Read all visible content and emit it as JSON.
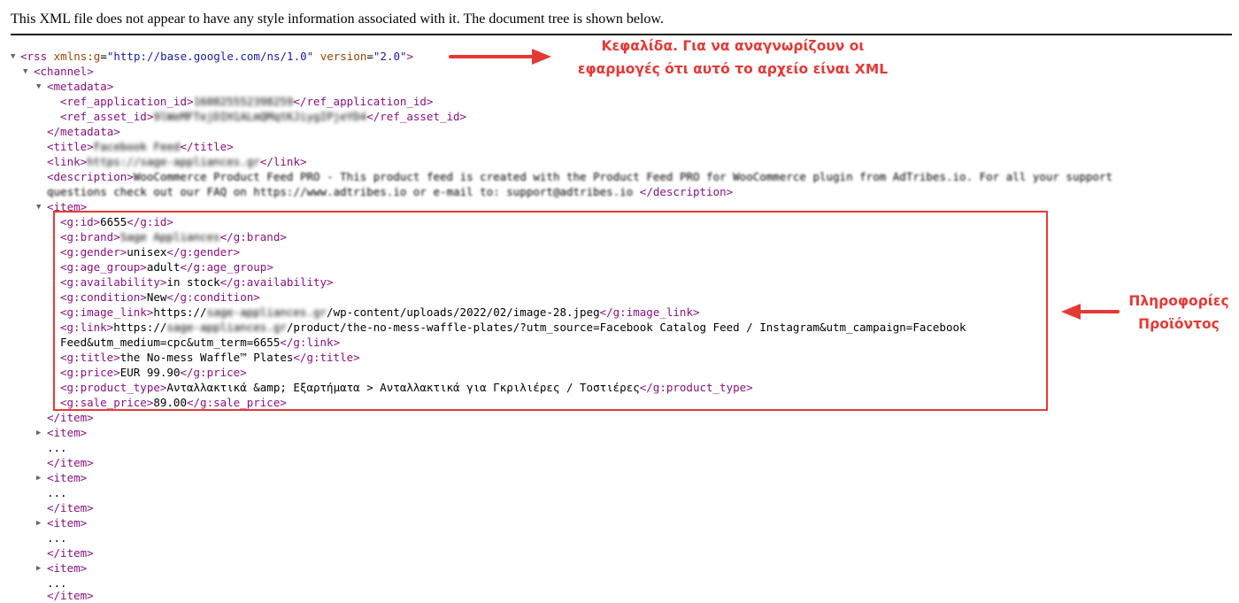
{
  "header_text": "This XML file does not appear to have any style information associated with it. The document tree is shown below.",
  "rss": {
    "open_prefix": "<rss ",
    "xmlns_name": "xmlns:g",
    "xmlns_value": "\"http://base.google.com/ns/1.0\"",
    "version_name": "version",
    "version_value": "\"2.0\"",
    "close": ">"
  },
  "channel_open": "<channel>",
  "metadata_open": "<metadata>",
  "ref_app_open": "<ref_application_id>",
  "ref_app_value": "160825552398259",
  "ref_app_close": "</ref_application_id>",
  "ref_asset_open": "<ref_asset_id>",
  "ref_asset_value": "9lWeMFTejDIH1ALmQMqtKJiygIPjeYD4",
  "ref_asset_close": "</ref_asset_id>",
  "metadata_close": "</metadata>",
  "title_open": "<title>",
  "title_value": "Facebook Feed",
  "title_close": "</title>",
  "link_open": "<link>",
  "link_value": "https://sage-appliances.gr",
  "link_close": "</link>",
  "desc_open": "<description>",
  "desc_line1": "WooCommerce Product Feed PRO - This product feed is created with the Product Feed PRO for WooCommerce plugin from AdTribes.io. For all your support",
  "desc_line2": "questions check out our FAQ on https://www.adtribes.io or e-mail to: support@adtribes.io ",
  "desc_close": "</description>",
  "item_open": "<item>",
  "item_close": "</item>",
  "ellipsis": "...",
  "fields": {
    "id": {
      "o": "<g:id>",
      "v": "6655",
      "c": "</g:id>"
    },
    "brand": {
      "o": "<g:brand>",
      "v": "Sage Appliances",
      "c": "</g:brand>"
    },
    "gender": {
      "o": "<g:gender>",
      "v": "unisex",
      "c": "</g:gender>"
    },
    "age_group": {
      "o": "<g:age_group>",
      "v": "adult",
      "c": "</g:age_group>"
    },
    "availability": {
      "o": "<g:availability>",
      "v": "in stock",
      "c": "</g:availability>"
    },
    "condition": {
      "o": "<g:condition>",
      "v": "New",
      "c": "</g:condition>"
    },
    "image_link": {
      "o": "<g:image_link>",
      "v1": "https://",
      "vb": "sage-appliances.gr",
      "v2": "/wp-content/uploads/2022/02/image-28.jpeg",
      "c": "</g:image_link>"
    },
    "link": {
      "o": "<g:link>",
      "v1": "https://",
      "vb": "sage-appliances.gr",
      "v2": "/product/the-no-mess-waffle-plates/?utm_source=Facebook Catalog Feed / Instagram&utm_campaign=Facebook",
      "v3": "Feed&utm_medium=cpc&utm_term=6655",
      "c": "</g:link>"
    },
    "title": {
      "o": "<g:title>",
      "v": "the No-mess Waffle™ Plates",
      "c": "</g:title>"
    },
    "price": {
      "o": "<g:price>",
      "v": "EUR 99.90",
      "c": "</g:price>"
    },
    "product_type": {
      "o": "<g:product_type>",
      "v": "Ανταλλακτικά &amp; Εξαρτήματα > Ανταλλακτικά για Γκριλιέρες / Τοστιέρες",
      "c": "</g:product_type>"
    },
    "sale_price": {
      "o": "<g:sale_price>",
      "v": "89.00",
      "c": "</g:sale_price>"
    }
  },
  "annotations": {
    "header_note_line1": "Κεφαλίδα. Για να αναγνωρίζουν οι",
    "header_note_line2": "εφαρμογές ότι αυτό το αρχείο είναι XML",
    "product_note_line1": "Πληροφορίες",
    "product_note_line2": "Προϊόντος",
    "color": "#e53935"
  },
  "toggle_expanded": "▼",
  "toggle_collapsed": "▶"
}
